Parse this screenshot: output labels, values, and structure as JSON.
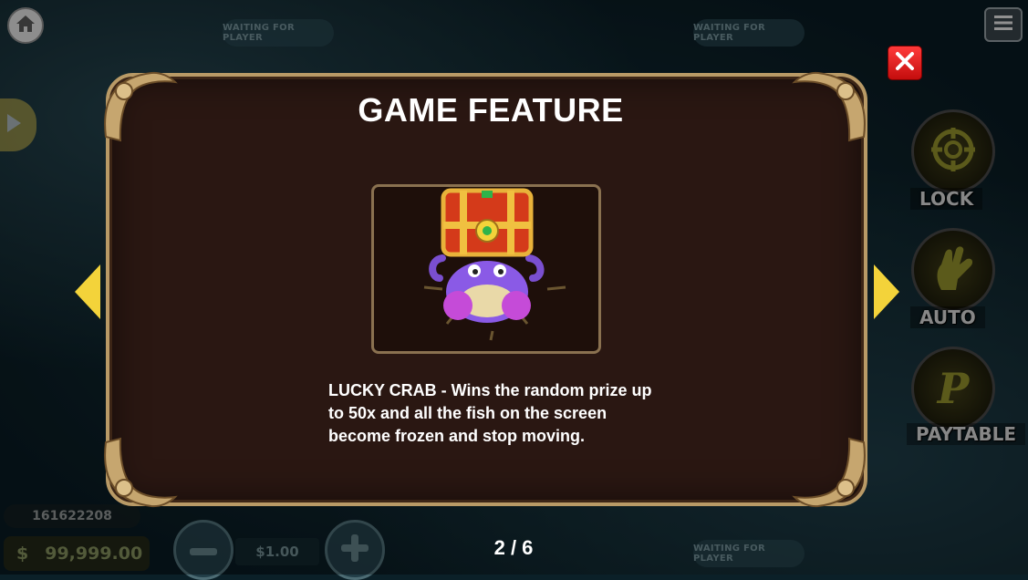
{
  "seats": {
    "top_left": "WAITING FOR PLAYER",
    "top_right": "WAITING FOR PLAYER",
    "bottom_right": "WAITING FOR PLAYER"
  },
  "side_controls": {
    "lock_label": "LOCK",
    "auto_label": "AUTO",
    "paytable_label": "PAYTABLE",
    "paytable_glyph": "P"
  },
  "player": {
    "score": "161622208",
    "currency": "$",
    "balance": "99,999.00",
    "bet": "$1.00"
  },
  "modal": {
    "title": "GAME FEATURE",
    "description": "LUCKY CRAB - Wins the random prize up to 50x and all the fish on the screen become frozen and stop moving.",
    "page": "2 / 6"
  },
  "colors": {
    "accent_gold": "#f3d33a",
    "close_red": "#e21a1a",
    "panel_bg": "#2a1712",
    "frame_gold": "#b99a66"
  },
  "icons": [
    "home-icon",
    "menu-icon",
    "close-icon",
    "prev-arrow-icon",
    "next-arrow-icon",
    "crosshair-icon",
    "auto-hand-icon",
    "paytable-icon",
    "lucky-crab-icon",
    "play-icon",
    "minus-icon",
    "plus-icon"
  ]
}
